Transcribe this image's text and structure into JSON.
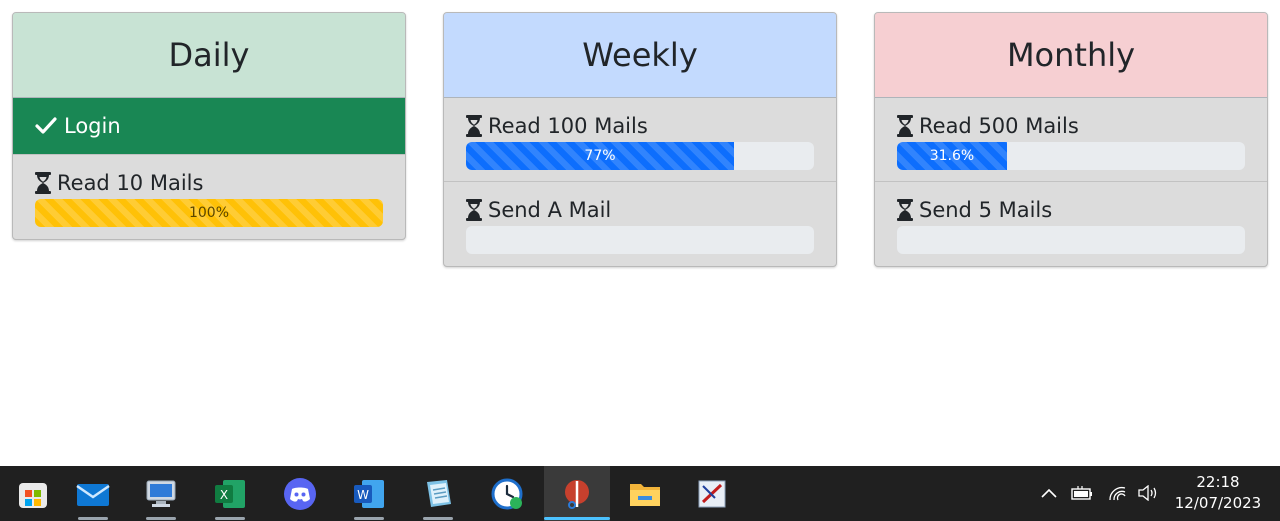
{
  "colors": {
    "daily_header": "#c8e3d4",
    "weekly_header": "#c3dafe",
    "monthly_header": "#f6cfd2",
    "success": "#198754",
    "primary": "#0d6efd",
    "warning": "#ffc107",
    "card_body": "#dcdcdc",
    "track": "#e9ecef"
  },
  "cards": [
    {
      "title": "Daily",
      "completed": [
        {
          "label": "Login",
          "icon": "check-icon"
        }
      ],
      "tasks": [
        {
          "label": "Read 10 Mails",
          "icon": "hourglass-icon",
          "progress": 100,
          "progress_label": "100%",
          "bar_color": "yellow"
        }
      ]
    },
    {
      "title": "Weekly",
      "tasks": [
        {
          "label": "Read 100 Mails",
          "icon": "hourglass-icon",
          "progress": 77,
          "progress_label": "77%",
          "bar_color": "blue"
        },
        {
          "label": "Send A Mail",
          "icon": "hourglass-icon",
          "progress": 0,
          "progress_label": "",
          "bar_color": "blue"
        }
      ]
    },
    {
      "title": "Monthly",
      "tasks": [
        {
          "label": "Read 500 Mails",
          "icon": "hourglass-icon",
          "progress": 31.6,
          "progress_label": "31.6%",
          "bar_color": "blue"
        },
        {
          "label": "Send 5 Mails",
          "icon": "hourglass-icon",
          "progress": 0,
          "progress_label": "",
          "bar_color": "blue"
        }
      ]
    }
  ],
  "taskbar": {
    "apps": [
      {
        "name": "start-icon"
      },
      {
        "name": "mail-app-icon"
      },
      {
        "name": "remote-desktop-icon"
      },
      {
        "name": "excel-icon",
        "letter": "X"
      },
      {
        "name": "discord-icon"
      },
      {
        "name": "word-icon",
        "letter": "W"
      },
      {
        "name": "notepad-app-icon"
      },
      {
        "name": "clock-app-icon"
      },
      {
        "name": "active-app-icon",
        "active": true
      },
      {
        "name": "file-explorer-icon"
      },
      {
        "name": "paint-app-icon"
      }
    ],
    "tray": [
      "chevron-up-icon",
      "battery-icon",
      "wifi-icon",
      "volume-icon"
    ],
    "time": "22:18",
    "date": "12/07/2023"
  }
}
